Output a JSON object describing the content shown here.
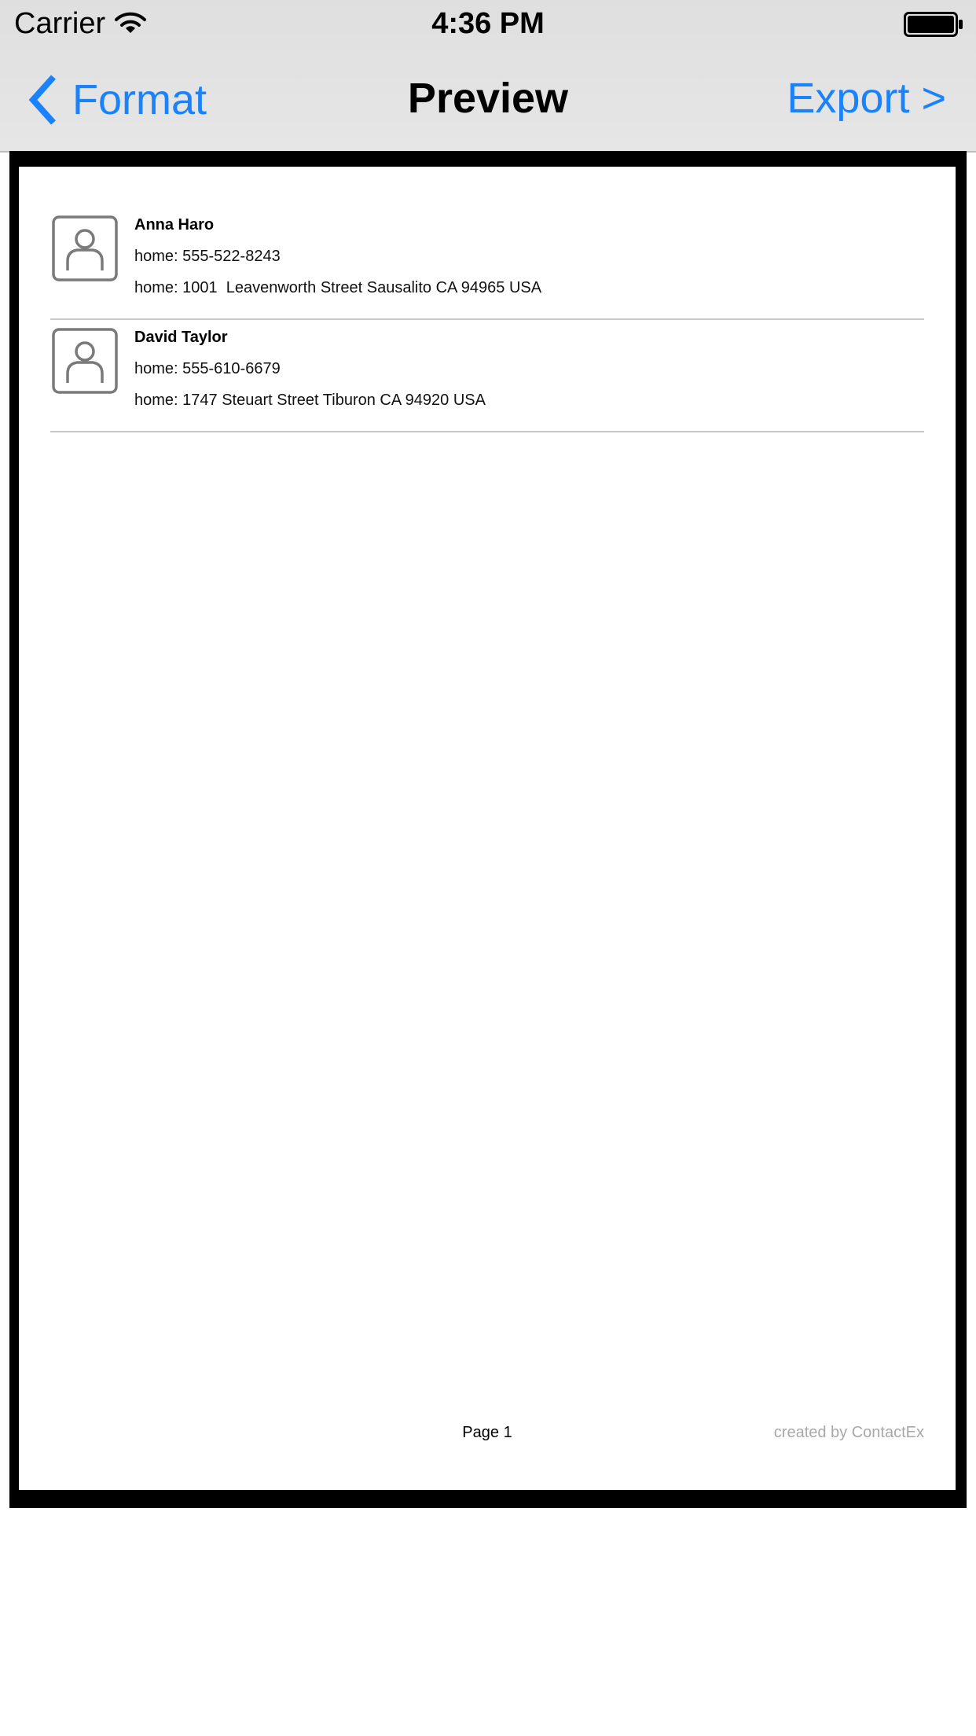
{
  "status_bar": {
    "carrier": "Carrier",
    "time": "4:36 PM",
    "wifi_icon": "wifi-icon",
    "battery_icon": "battery-full-icon"
  },
  "nav": {
    "back_label": "Format",
    "back_icon": "chevron-left-icon",
    "title": "Preview",
    "export_label": "Export >"
  },
  "colors": {
    "accent": "#1a82fb",
    "frame": "#000000",
    "footer_text": "#a8a8a8",
    "separator": "#c7c7c7"
  },
  "contacts": [
    {
      "name": "Anna Haro",
      "phone": "home: 555-522-8243",
      "address": "home: 1001  Leavenworth Street Sausalito CA 94965 USA",
      "avatar_icon": "person-placeholder-icon"
    },
    {
      "name": "David Taylor",
      "phone": "home: 555-610-6679",
      "address": "home: 1747 Steuart Street Tiburon CA 94920 USA",
      "avatar_icon": "person-placeholder-icon"
    }
  ],
  "footer": {
    "page_label": "Page 1",
    "created_by": "created by ContactEx"
  }
}
